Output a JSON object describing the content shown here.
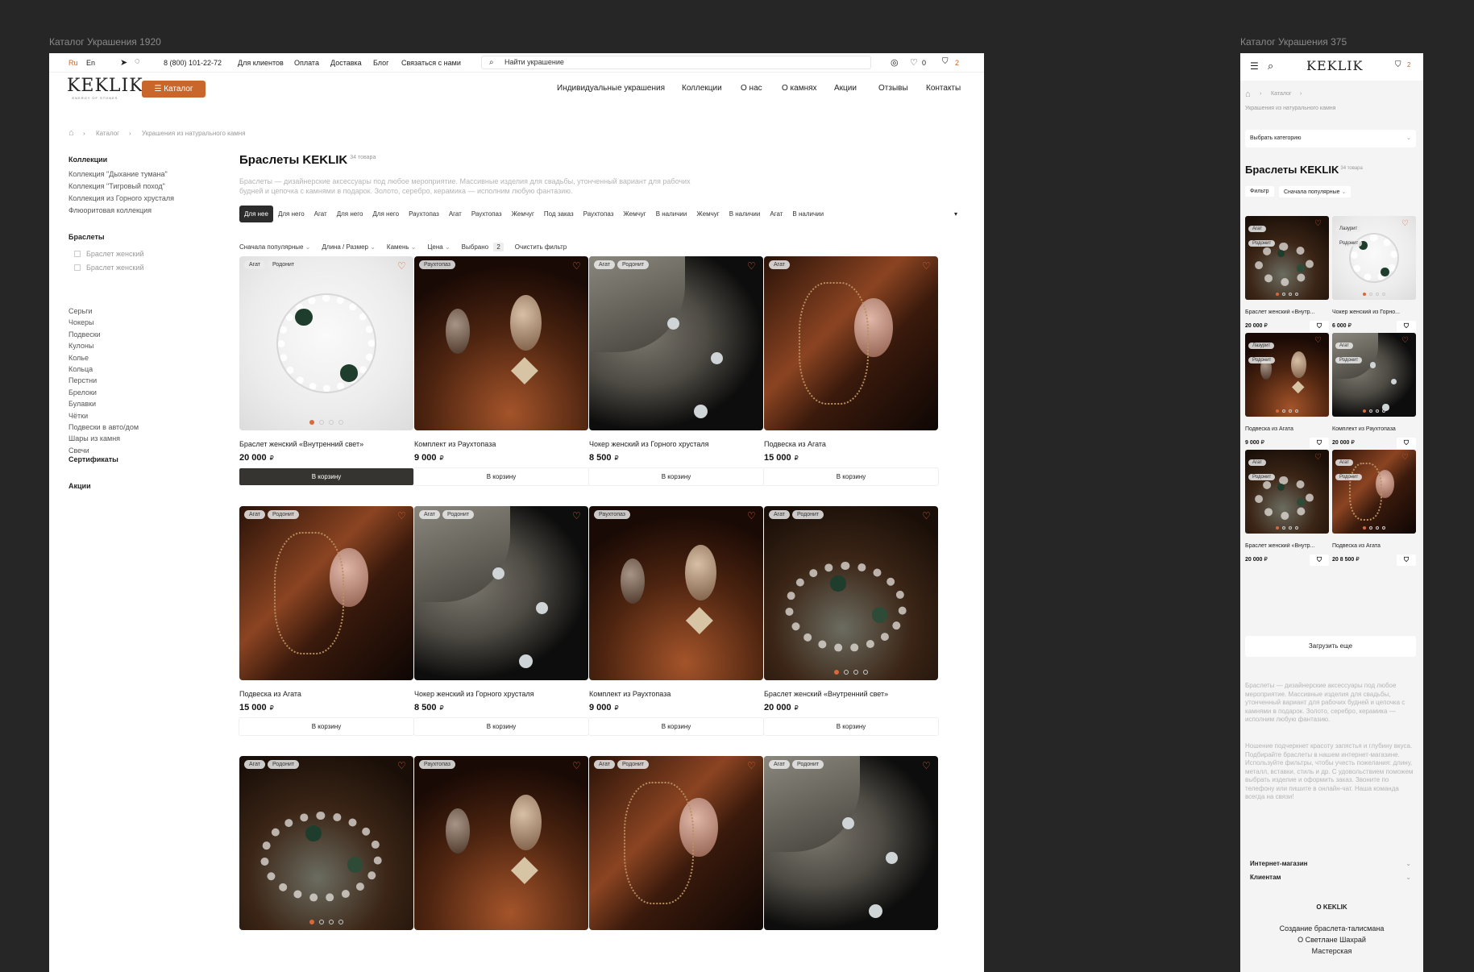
{
  "frames": {
    "desktop_label": "Каталог Украшения 1920",
    "mobile_label": "Каталог Украшения 375"
  },
  "colors": {
    "accent": "#c8662c",
    "dark_button": "#363431",
    "canvas": "#262626"
  },
  "topbar": {
    "lang_ru": "Ru",
    "lang_en": "En",
    "phone": "8 (800) 101-22-72",
    "links": [
      "Для клиентов",
      "Оплата",
      "Доставка",
      "Блог",
      "Связаться с нами"
    ],
    "search_placeholder": "Найти украшение",
    "wishlist_count": "0",
    "cart_count": "2"
  },
  "logo": {
    "text": "KEKLIK",
    "sub": "ENERGY OF STONES"
  },
  "header": {
    "catalog_button": "Каталог",
    "nav": [
      "Индивидуальные украшения",
      "Коллекции",
      "О нас",
      "О камнях",
      "Акции",
      "Отзывы",
      "Контакты"
    ]
  },
  "breadcrumb": [
    "Каталог",
    "Украшения из натурального камня"
  ],
  "sidebar": {
    "collections_title": "Коллекции",
    "collections": [
      "Коллекция \"Дыхание тумана\"",
      "Коллекция \"Тигровый поход\"",
      "Коллекция из Горного хрусталя",
      "Флюоритовая коллекция"
    ],
    "bracelets_title": "Браслеты",
    "bracelets": [
      "Браслет женский",
      "Браслет женский"
    ],
    "categories": [
      "Серьги",
      "Чокеры",
      "Подвески",
      "Кулоны",
      "Колье",
      "Кольца",
      "Перстни",
      "Брелоки",
      "Булавки",
      "Чётки",
      "Подвески в авто/дом",
      "Шары из камня",
      "Свечи"
    ],
    "certificates": "Сертификаты",
    "promos": "Акции"
  },
  "page": {
    "title": "Браслеты KEKLIK",
    "count": "34 товара",
    "description": "Браслеты — дизайнерские аксессуары под любое мероприятие. Массивные изделия для свадьбы, утонченный вариант для рабочих будней и цепочка с камнями в подарок. Золото, серебро, керамика — исполним любую фантазию."
  },
  "chips": [
    "Для нее",
    "Для него",
    "Агат",
    "Для него",
    "Для него",
    "Раухтопаз",
    "Агат",
    "Раухтопаз",
    "Жемчуг",
    "Под заказ",
    "Раухтопаз",
    "Жемчуг",
    "В наличии",
    "Жемчуг",
    "В наличии",
    "Агат",
    "В наличии"
  ],
  "filters": {
    "sort": "Сначала популярные",
    "length": "Длина / Размер",
    "stone": "Камень",
    "price": "Цена",
    "selected_label": "Выбрано",
    "selected_count": "2",
    "clear": "Очистить фильтр"
  },
  "cart_button": "В корзину",
  "currency": "₽",
  "products": [
    {
      "name": "Браслет женский «Внутренний свет»",
      "price": "20 000",
      "tags": [
        "Агат",
        "Родонит"
      ],
      "img": "white-bracelet",
      "dots": 4,
      "active": true
    },
    {
      "name": "Комплект из Раухтопаза",
      "price": "9 000",
      "tags": [
        "Раухтопаз"
      ],
      "img": "smoky",
      "dots": 0
    },
    {
      "name": "Чокер женский из Горного хрусталя",
      "price": "8 500",
      "tags": [
        "Агат",
        "Родонит"
      ],
      "img": "crystal",
      "dots": 0
    },
    {
      "name": "Подвеска из Агата",
      "price": "15 000",
      "tags": [
        "Агат"
      ],
      "img": "agate",
      "dots": 0
    },
    {
      "name": "Подвеска из Агата",
      "price": "15 000",
      "tags": [
        "Агат",
        "Родонит"
      ],
      "img": "agate",
      "dots": 0
    },
    {
      "name": "Чокер женский из Горного хрусталя",
      "price": "8 500",
      "tags": [
        "Агат",
        "Родонит"
      ],
      "img": "crystal",
      "dots": 0
    },
    {
      "name": "Комплект из Раухтопаза",
      "price": "9 000",
      "tags": [
        "Раухтопаз"
      ],
      "img": "smoky",
      "dots": 0
    },
    {
      "name": "Браслет женский «Внутренний свет»",
      "price": "20 000",
      "tags": [
        "Агат",
        "Родонит"
      ],
      "img": "green-bracelet",
      "dots": 4
    },
    {
      "name": "",
      "price": "",
      "tags": [
        "Агат",
        "Родонит"
      ],
      "img": "green-bracelet",
      "dots": 4
    },
    {
      "name": "",
      "price": "",
      "tags": [
        "Раухтопаз"
      ],
      "img": "smoky",
      "dots": 0
    },
    {
      "name": "",
      "price": "",
      "tags": [
        "Агат",
        "Родонит"
      ],
      "img": "agate",
      "dots": 0
    },
    {
      "name": "",
      "price": "",
      "tags": [
        "Агат",
        "Родонит"
      ],
      "img": "crystal",
      "dots": 0
    }
  ],
  "mobile": {
    "breadcrumb": [
      "Каталог",
      "Украшения из натурального камня"
    ],
    "category_select": "Выбрать категорию",
    "filter_btn": "Фильтр",
    "sort": "Сначала популярные",
    "load_more": "Загрузить еще",
    "products": [
      {
        "name": "Браслет женский «Внутр...",
        "price": "20 000",
        "tags": [
          "Агат",
          "Родонит"
        ],
        "img": "green-bracelet",
        "dots": 4
      },
      {
        "name": "Чокер женский из Горно...",
        "price": "6 000",
        "tags": [
          "Лазурит",
          "Родонит"
        ],
        "img": "white-bracelet",
        "dots": 4
      },
      {
        "name": "Подвеска из Агата",
        "price": "9 000",
        "tags": [
          "Лазурит",
          "Родонит"
        ],
        "img": "smoky",
        "dots": 4
      },
      {
        "name": "Комплект из Раухтопаза",
        "price": "20 000",
        "tags": [
          "Агат",
          "Родонит"
        ],
        "img": "crystal",
        "dots": 4
      },
      {
        "name": "Браслет женский «Внутр...",
        "price": "20 000",
        "tags": [
          "Агат",
          "Родонит"
        ],
        "img": "green-bracelet",
        "dots": 4
      },
      {
        "name": "Подвеска из Агата",
        "price": "20 8 500",
        "tags": [
          "Агат",
          "Родонит"
        ],
        "img": "agate",
        "dots": 4
      }
    ],
    "desc1": "Браслеты — дизайнерские аксессуары под любое мероприятие. Массивные изделия для свадьбы, утонченный вариант для рабочих будней и цепочка с камнями в подарок. Золото, серебро, керамика — исполним любую фантазию.",
    "desc2": "Ношение подчеркнет красоту запястья и глубину вкуса. Подбирайте браслеты в нашем интернет-магазине. Используйте фильтры, чтобы учесть пожелания: длину, металл, вставки, стиль и др. С удовольствием поможем выбрать изделие и оформить заказ. Звоните по телефону или пишите в онлайн-чат. Наша команда всегда на связи!",
    "footer_sections": [
      "Интернет-магазин",
      "Клиентам"
    ],
    "footer_title": "О KEKLIK",
    "footer_links": [
      "Создание браслета-талисмана",
      "О Светлане Шахрай",
      "Мастерская"
    ]
  }
}
